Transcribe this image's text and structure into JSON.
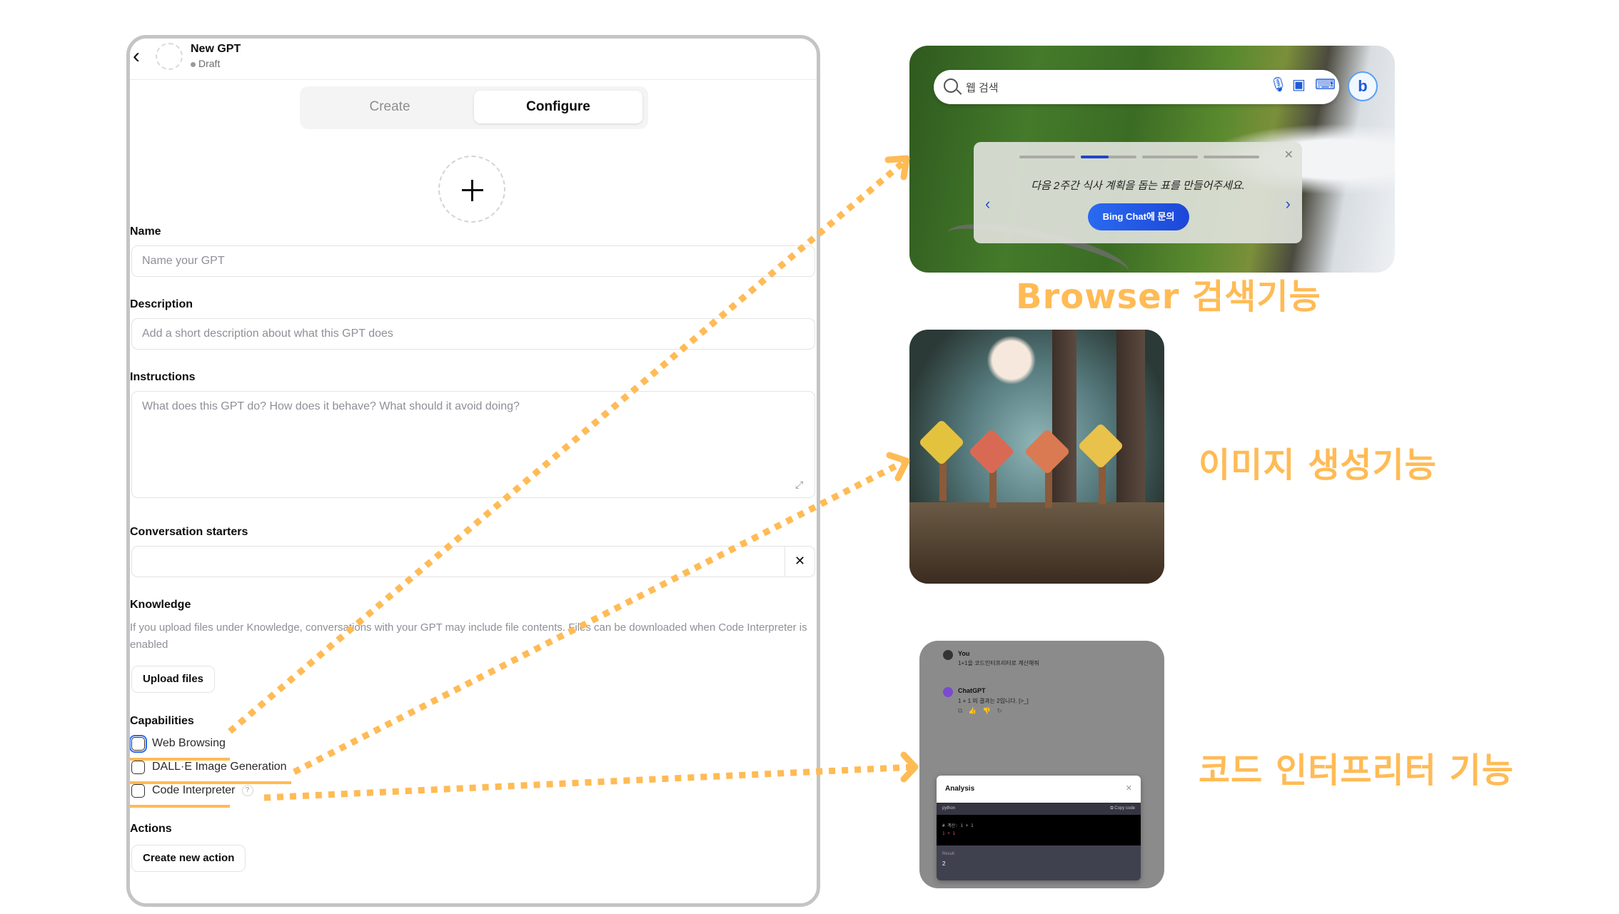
{
  "header": {
    "back_icon": "chevron-left-icon",
    "title": "New GPT",
    "status": "Draft"
  },
  "tabs": [
    {
      "label": "Create",
      "active": false
    },
    {
      "label": "Configure",
      "active": true
    }
  ],
  "form": {
    "name": {
      "label": "Name",
      "value": "",
      "placeholder": "Name your GPT"
    },
    "description": {
      "label": "Description",
      "value": "",
      "placeholder": "Add a short description about what this GPT does"
    },
    "instructions": {
      "label": "Instructions",
      "value": "",
      "placeholder": "What does this GPT do? How does it behave? What should it avoid doing?"
    },
    "conversation_starters": {
      "label": "Conversation starters",
      "value": "",
      "clear_label": "✕"
    },
    "knowledge": {
      "label": "Knowledge",
      "helper": "If you upload files under Knowledge, conversations with your GPT may include file contents. Files can be downloaded when Code Interpreter is enabled",
      "upload_label": "Upload files"
    },
    "capabilities": {
      "label": "Capabilities",
      "items": [
        {
          "label": "Web Browsing",
          "checked": false
        },
        {
          "label": "DALL·E Image Generation",
          "checked": false
        },
        {
          "label": "Code Interpreter",
          "checked": false,
          "help": "?"
        }
      ]
    },
    "actions": {
      "label": "Actions",
      "create_label": "Create new action"
    }
  },
  "browser_panel": {
    "search_placeholder": "웹 검색",
    "prompt_text": "다음 2주간 식사 계획을 돕는 표를 만들어주세요.",
    "button_label": "Bing Chat에 문의",
    "carousel_index": 2,
    "carousel_count": 4,
    "carousel_progress": 0.5,
    "close": "✕",
    "prev": "‹",
    "next": "›",
    "bing_logo": "b",
    "caption": "Browser 검색기능"
  },
  "image_panel": {
    "caption": "이미지 생성기능"
  },
  "code_panel": {
    "user_name": "You",
    "user_message": "1+1을 코드인터프리터로 계산해줘",
    "assistant_name": "ChatGPT",
    "assistant_message": "1 + 1 의 결과는 2입니다. [>_]",
    "tools": "⧉ 👍 👎 ↻",
    "analysis_title": "Analysis",
    "analysis_close": "✕",
    "language": "python",
    "copy_label": "⧉ Copy code",
    "code_line1": "# 계산: 1 + 1",
    "code_line2": "1 + 1",
    "result_label": "Result",
    "result_value": "2",
    "caption": "코드 인터프리터 기능"
  },
  "colors": {
    "accent_orange": "#ffbb55",
    "focus_blue": "#2b6bec",
    "bing_blue": "#1f5ad8"
  }
}
